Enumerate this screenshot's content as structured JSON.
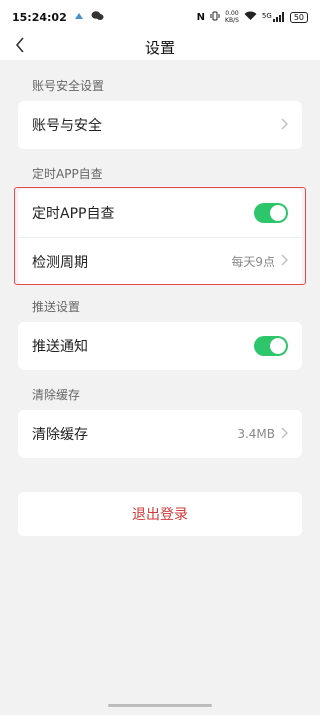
{
  "status_bar": {
    "time": "15:24:02",
    "net_speed_value": "0.00",
    "net_speed_unit": "KB/S",
    "network_type": "5G",
    "battery": "50"
  },
  "header": {
    "title": "设置"
  },
  "sections": {
    "account": {
      "header": "账号安全设置",
      "row_label": "账号与安全"
    },
    "auto_check": {
      "header": "定时APP自查",
      "toggle_label": "定时APP自查",
      "toggle_on": true,
      "period_label": "检测周期",
      "period_value": "每天9点"
    },
    "push": {
      "header": "推送设置",
      "toggle_label": "推送通知",
      "toggle_on": true
    },
    "cache": {
      "header": "清除缓存",
      "row_label": "清除缓存",
      "value": "3.4MB"
    }
  },
  "logout": {
    "label": "退出登录"
  },
  "colors": {
    "toggle_on": "#2ec66b",
    "highlight_border": "#e24b4b",
    "logout_text": "#d23a3a",
    "background": "#f2f2f2"
  },
  "icons": [
    "back-arrow-icon",
    "chevron-right-icon",
    "wifi-icon",
    "signal-icon",
    "battery-icon",
    "nfc-icon"
  ]
}
